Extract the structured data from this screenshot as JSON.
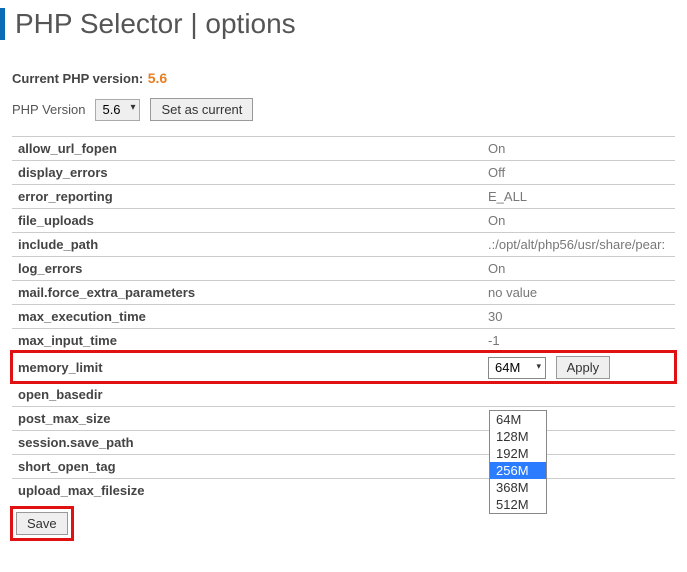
{
  "header": {
    "title": "PHP Selector | options"
  },
  "current": {
    "label": "Current PHP version:",
    "value": "5.6"
  },
  "versionRow": {
    "label": "PHP Version",
    "selected": "5.6",
    "button": "Set as current"
  },
  "options": [
    {
      "key": "allow_url_fopen",
      "val": "On"
    },
    {
      "key": "display_errors",
      "val": "Off"
    },
    {
      "key": "error_reporting",
      "val": "E_ALL"
    },
    {
      "key": "file_uploads",
      "val": "On"
    },
    {
      "key": "include_path",
      "val": ".:/opt/alt/php56/usr/share/pear:"
    },
    {
      "key": "log_errors",
      "val": "On"
    },
    {
      "key": "mail.force_extra_parameters",
      "val": "no value"
    },
    {
      "key": "max_execution_time",
      "val": "30"
    },
    {
      "key": "max_input_time",
      "val": "-1"
    }
  ],
  "memory": {
    "key": "memory_limit",
    "selected": "64M",
    "apply": "Apply",
    "choices": [
      "64M",
      "128M",
      "192M",
      "256M",
      "368M",
      "512M"
    ],
    "highlighted": "256M"
  },
  "options2": [
    {
      "key": "open_basedir",
      "val": ""
    },
    {
      "key": "post_max_size",
      "val": ""
    },
    {
      "key": "session.save_path",
      "val": ""
    },
    {
      "key": "short_open_tag",
      "val": ""
    },
    {
      "key": "upload_max_filesize",
      "val": ""
    }
  ],
  "save": {
    "label": "Save"
  }
}
